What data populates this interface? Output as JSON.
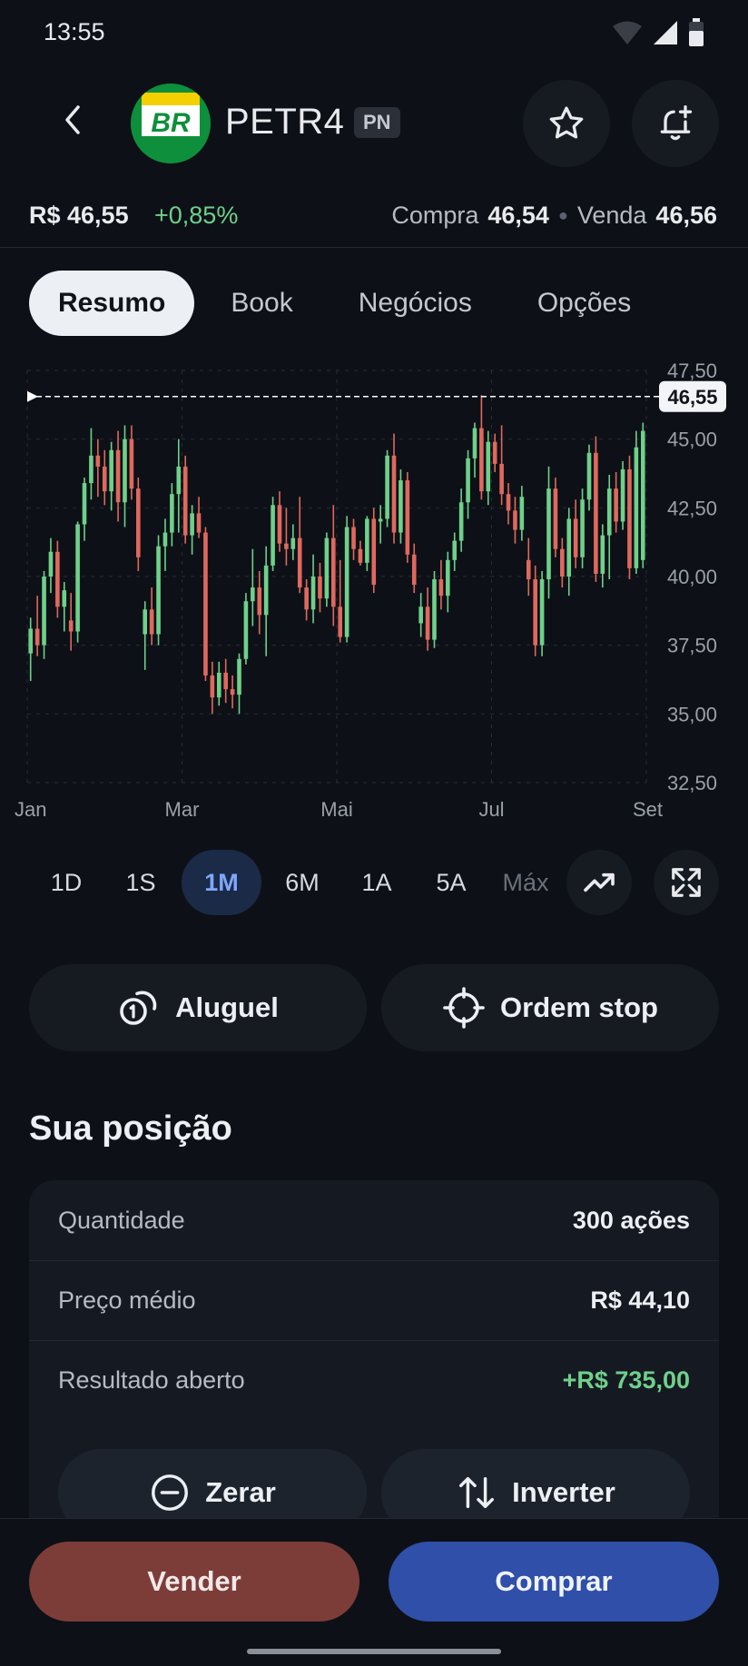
{
  "status_bar": {
    "time": "13:55"
  },
  "header": {
    "ticker": "PETR4",
    "badge": "PN",
    "logo_text": "BR"
  },
  "quote": {
    "price": "R$ 46,55",
    "change": "+0,85%",
    "bid_label": "Compra",
    "bid": "46,54",
    "ask_label": "Venda",
    "ask": "46,56"
  },
  "tabs": [
    {
      "label": "Resumo",
      "active": true
    },
    {
      "label": "Book",
      "active": false
    },
    {
      "label": "Negócios",
      "active": false
    },
    {
      "label": "Opções",
      "active": false
    }
  ],
  "chart_data": {
    "type": "candlestick",
    "x_tick_labels": [
      "Jan",
      "Mar",
      "Mai",
      "Jul",
      "Set"
    ],
    "y_tick_labels": [
      "47,50",
      "45,00",
      "42,50",
      "40,00",
      "37,50",
      "35,00",
      "32,50"
    ],
    "ylim": [
      32.5,
      47.5
    ],
    "last_price": 46.55,
    "last_price_label": "46,55",
    "grid": true,
    "colors": {
      "up": "#6fd08a",
      "down": "#e0685e"
    },
    "candles": [
      {
        "o": 37.2,
        "h": 38.5,
        "l": 36.2,
        "c": 38.1
      },
      {
        "o": 38.1,
        "h": 39.3,
        "l": 37.1,
        "c": 37.5
      },
      {
        "o": 37.5,
        "h": 40.2,
        "l": 37.0,
        "c": 40.0
      },
      {
        "o": 40.0,
        "h": 41.4,
        "l": 39.4,
        "c": 40.9
      },
      {
        "o": 40.9,
        "h": 41.3,
        "l": 38.5,
        "c": 38.9
      },
      {
        "o": 38.9,
        "h": 39.8,
        "l": 38.0,
        "c": 39.5
      },
      {
        "o": 38.4,
        "h": 39.4,
        "l": 37.3,
        "c": 38.0
      },
      {
        "o": 38.0,
        "h": 42.0,
        "l": 37.6,
        "c": 41.9
      },
      {
        "o": 41.9,
        "h": 43.6,
        "l": 41.3,
        "c": 43.4
      },
      {
        "o": 43.4,
        "h": 45.4,
        "l": 42.8,
        "c": 44.4
      },
      {
        "o": 44.4,
        "h": 45.0,
        "l": 42.9,
        "c": 44.0
      },
      {
        "o": 44.0,
        "h": 44.6,
        "l": 42.6,
        "c": 43.1
      },
      {
        "o": 43.1,
        "h": 44.9,
        "l": 42.4,
        "c": 44.6
      },
      {
        "o": 44.6,
        "h": 45.3,
        "l": 42.0,
        "c": 42.7
      },
      {
        "o": 42.7,
        "h": 45.5,
        "l": 41.8,
        "c": 45.0
      },
      {
        "o": 45.0,
        "h": 45.5,
        "l": 42.8,
        "c": 43.2
      },
      {
        "o": 43.2,
        "h": 43.6,
        "l": 40.2,
        "c": 40.7
      },
      {
        "o": 37.9,
        "h": 39.1,
        "l": 36.6,
        "c": 38.8
      },
      {
        "o": 38.8,
        "h": 39.6,
        "l": 37.5,
        "c": 37.9
      },
      {
        "o": 37.9,
        "h": 41.5,
        "l": 37.5,
        "c": 41.1
      },
      {
        "o": 41.1,
        "h": 42.1,
        "l": 40.2,
        "c": 41.6
      },
      {
        "o": 41.6,
        "h": 43.4,
        "l": 41.1,
        "c": 43.0
      },
      {
        "o": 43.0,
        "h": 45.0,
        "l": 41.6,
        "c": 44.0
      },
      {
        "o": 44.0,
        "h": 44.4,
        "l": 41.2,
        "c": 41.5
      },
      {
        "o": 41.5,
        "h": 42.6,
        "l": 40.8,
        "c": 42.3
      },
      {
        "o": 42.3,
        "h": 42.9,
        "l": 41.4,
        "c": 41.6
      },
      {
        "o": 41.6,
        "h": 41.8,
        "l": 36.2,
        "c": 36.4
      },
      {
        "o": 36.4,
        "h": 36.9,
        "l": 35.0,
        "c": 35.6
      },
      {
        "o": 35.6,
        "h": 36.9,
        "l": 35.3,
        "c": 36.5
      },
      {
        "o": 36.5,
        "h": 37.0,
        "l": 35.4,
        "c": 35.9
      },
      {
        "o": 35.9,
        "h": 36.4,
        "l": 35.2,
        "c": 35.7
      },
      {
        "o": 35.7,
        "h": 37.2,
        "l": 35.0,
        "c": 37.0
      },
      {
        "o": 37.0,
        "h": 39.4,
        "l": 36.8,
        "c": 39.1
      },
      {
        "o": 39.1,
        "h": 41.0,
        "l": 38.2,
        "c": 39.6
      },
      {
        "o": 39.6,
        "h": 40.2,
        "l": 37.9,
        "c": 38.6
      },
      {
        "o": 38.6,
        "h": 41.1,
        "l": 37.1,
        "c": 40.4
      },
      {
        "o": 40.4,
        "h": 42.9,
        "l": 40.2,
        "c": 42.6
      },
      {
        "o": 42.6,
        "h": 43.1,
        "l": 40.9,
        "c": 41.2
      },
      {
        "o": 41.2,
        "h": 42.5,
        "l": 40.4,
        "c": 41.0
      },
      {
        "o": 41.0,
        "h": 41.9,
        "l": 40.6,
        "c": 41.4
      },
      {
        "o": 41.4,
        "h": 42.9,
        "l": 39.4,
        "c": 39.6
      },
      {
        "o": 39.6,
        "h": 39.9,
        "l": 38.4,
        "c": 38.8
      },
      {
        "o": 38.8,
        "h": 40.8,
        "l": 38.3,
        "c": 40.0
      },
      {
        "o": 40.0,
        "h": 40.5,
        "l": 38.7,
        "c": 39.2
      },
      {
        "o": 39.2,
        "h": 41.6,
        "l": 38.9,
        "c": 41.4
      },
      {
        "o": 41.4,
        "h": 42.6,
        "l": 38.2,
        "c": 38.9
      },
      {
        "o": 38.9,
        "h": 40.6,
        "l": 37.6,
        "c": 37.8
      },
      {
        "o": 37.8,
        "h": 42.2,
        "l": 37.6,
        "c": 41.8
      },
      {
        "o": 41.8,
        "h": 42.1,
        "l": 40.6,
        "c": 41.0
      },
      {
        "o": 41.0,
        "h": 41.3,
        "l": 40.4,
        "c": 40.5
      },
      {
        "o": 40.5,
        "h": 42.2,
        "l": 40.2,
        "c": 42.1
      },
      {
        "o": 42.1,
        "h": 42.5,
        "l": 39.4,
        "c": 39.7
      },
      {
        "o": 42.0,
        "h": 42.6,
        "l": 41.2,
        "c": 42.1
      },
      {
        "o": 42.1,
        "h": 44.6,
        "l": 41.8,
        "c": 44.4
      },
      {
        "o": 44.4,
        "h": 45.2,
        "l": 41.2,
        "c": 41.6
      },
      {
        "o": 41.6,
        "h": 43.9,
        "l": 41.2,
        "c": 43.5
      },
      {
        "o": 43.5,
        "h": 43.8,
        "l": 40.5,
        "c": 40.8
      },
      {
        "o": 40.8,
        "h": 41.2,
        "l": 39.4,
        "c": 39.7
      },
      {
        "o": 38.3,
        "h": 39.4,
        "l": 37.8,
        "c": 38.9
      },
      {
        "o": 38.9,
        "h": 39.6,
        "l": 37.3,
        "c": 37.7
      },
      {
        "o": 37.7,
        "h": 40.2,
        "l": 37.4,
        "c": 39.9
      },
      {
        "o": 39.9,
        "h": 40.6,
        "l": 38.8,
        "c": 39.3
      },
      {
        "o": 39.3,
        "h": 40.9,
        "l": 38.7,
        "c": 40.6
      },
      {
        "o": 40.6,
        "h": 41.6,
        "l": 40.2,
        "c": 41.3
      },
      {
        "o": 41.3,
        "h": 43.2,
        "l": 40.9,
        "c": 42.7
      },
      {
        "o": 42.7,
        "h": 44.6,
        "l": 42.1,
        "c": 44.3
      },
      {
        "o": 44.3,
        "h": 45.6,
        "l": 43.6,
        "c": 45.4
      },
      {
        "o": 45.4,
        "h": 46.6,
        "l": 42.8,
        "c": 43.1
      },
      {
        "o": 43.1,
        "h": 45.3,
        "l": 42.6,
        "c": 44.9
      },
      {
        "o": 44.9,
        "h": 45.2,
        "l": 43.8,
        "c": 44.1
      },
      {
        "o": 44.1,
        "h": 45.5,
        "l": 42.6,
        "c": 43.0
      },
      {
        "o": 43.0,
        "h": 43.4,
        "l": 41.9,
        "c": 42.4
      },
      {
        "o": 42.4,
        "h": 42.9,
        "l": 41.2,
        "c": 41.7
      },
      {
        "o": 41.7,
        "h": 43.3,
        "l": 41.3,
        "c": 42.9
      },
      {
        "o": 40.6,
        "h": 41.4,
        "l": 39.3,
        "c": 39.9
      },
      {
        "o": 39.9,
        "h": 40.4,
        "l": 37.1,
        "c": 37.5
      },
      {
        "o": 37.5,
        "h": 40.2,
        "l": 37.1,
        "c": 39.9
      },
      {
        "o": 39.9,
        "h": 44.0,
        "l": 39.2,
        "c": 43.2
      },
      {
        "o": 43.2,
        "h": 43.6,
        "l": 40.7,
        "c": 41.0
      },
      {
        "o": 41.0,
        "h": 41.4,
        "l": 39.6,
        "c": 40.0
      },
      {
        "o": 40.0,
        "h": 42.5,
        "l": 39.3,
        "c": 42.1
      },
      {
        "o": 42.1,
        "h": 42.8,
        "l": 40.3,
        "c": 40.7
      },
      {
        "o": 40.7,
        "h": 43.2,
        "l": 40.3,
        "c": 42.8
      },
      {
        "o": 42.8,
        "h": 44.8,
        "l": 42.4,
        "c": 44.5
      },
      {
        "o": 44.5,
        "h": 45.1,
        "l": 39.8,
        "c": 40.1
      },
      {
        "o": 40.1,
        "h": 41.9,
        "l": 39.6,
        "c": 41.5
      },
      {
        "o": 41.5,
        "h": 43.7,
        "l": 39.9,
        "c": 43.2
      },
      {
        "o": 43.2,
        "h": 43.8,
        "l": 41.6,
        "c": 42.0
      },
      {
        "o": 42.0,
        "h": 44.2,
        "l": 41.7,
        "c": 43.9
      },
      {
        "o": 43.9,
        "h": 44.4,
        "l": 39.9,
        "c": 40.3
      },
      {
        "o": 40.3,
        "h": 45.3,
        "l": 40.1,
        "c": 44.7
      },
      {
        "o": 40.6,
        "h": 45.6,
        "l": 40.3,
        "c": 45.3
      }
    ]
  },
  "periods": [
    {
      "label": "1D",
      "active": false
    },
    {
      "label": "1S",
      "active": false
    },
    {
      "label": "1M",
      "active": true
    },
    {
      "label": "6M",
      "active": false
    },
    {
      "label": "1A",
      "active": false
    },
    {
      "label": "5A",
      "active": false
    },
    {
      "label": "Máx",
      "active": false
    }
  ],
  "actions": {
    "rent_label": "Aluguel",
    "stop_label": "Ordem stop"
  },
  "position": {
    "title": "Sua posição",
    "rows": [
      {
        "label": "Quantidade",
        "value": "300 ações"
      },
      {
        "label": "Preço médio",
        "value": "R$ 44,10"
      },
      {
        "label": "Resultado aberto",
        "value": "+R$ 735,00"
      }
    ],
    "zero_label": "Zerar",
    "invert_label": "Inverter"
  },
  "bottom": {
    "sell_label": "Vender",
    "buy_label": "Comprar"
  },
  "colors": {
    "accent": "#2f4fa8",
    "sell": "#7c3d39",
    "positive": "#6fd08a",
    "negative": "#e0685e"
  }
}
